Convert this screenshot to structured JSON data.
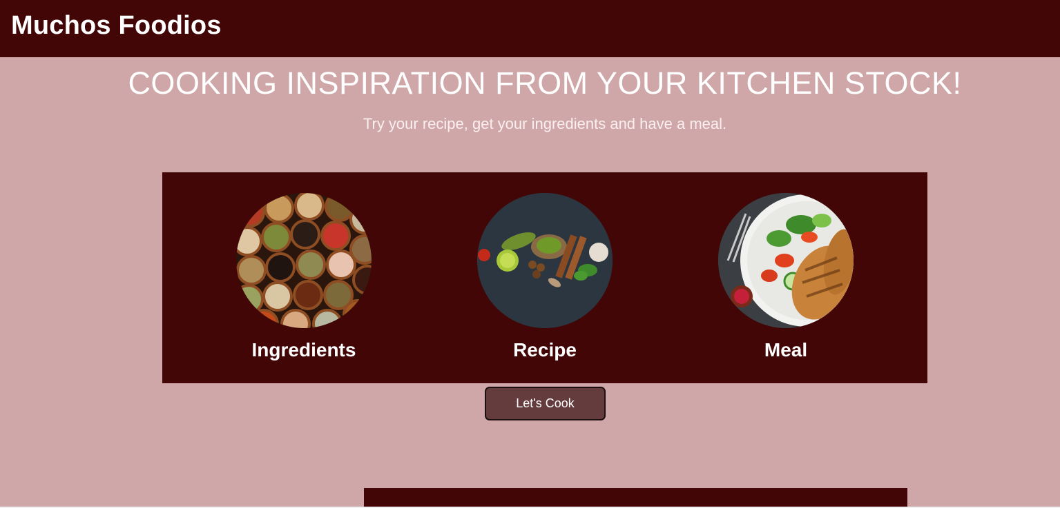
{
  "header": {
    "brand": "Muchos Foodios"
  },
  "hero": {
    "title": "COOKING INSPIRATION FROM YOUR KITCHEN STOCK!",
    "subtitle": "Try your recipe, get your ingredients and have a meal."
  },
  "steps": [
    {
      "label": "Ingredients",
      "icon": "spice-bowls-image"
    },
    {
      "label": "Recipe",
      "icon": "herbs-and-spices-image"
    },
    {
      "label": "Meal",
      "icon": "grilled-chicken-salad-image"
    }
  ],
  "cta": {
    "label": "Let's Cook"
  },
  "colors": {
    "background": "#cfa7a8",
    "brand_dark": "#420607",
    "button": "#653c3e"
  }
}
